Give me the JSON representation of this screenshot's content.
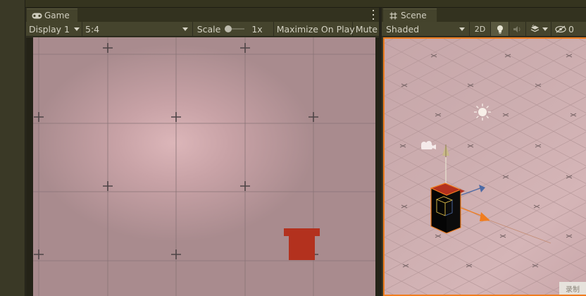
{
  "game": {
    "tab_label": "Game",
    "display_value": "Display 1",
    "aspect_value": "5:4",
    "scale_label": "Scale",
    "scale_value": "1x",
    "maximize_label": "Maximize On Play",
    "mute_label": "Mute"
  },
  "scene": {
    "tab_label": "Scene",
    "shading_value": "Shaded",
    "mode_2d_label": "2D",
    "hidden_count": "0",
    "corner_text": "录制"
  },
  "colors": {
    "selection_outline": "#f07d1f",
    "red_object": "#b3311e",
    "toolbar_bg": "#45442d"
  },
  "icons": {
    "game_tab": "gamepad-icon",
    "scene_tab": "grid-hash-icon",
    "lighting": "lightbulb-icon",
    "audio": "speaker-icon",
    "effects": "effects-layers-icon",
    "visibility": "eye-slash-icon"
  }
}
